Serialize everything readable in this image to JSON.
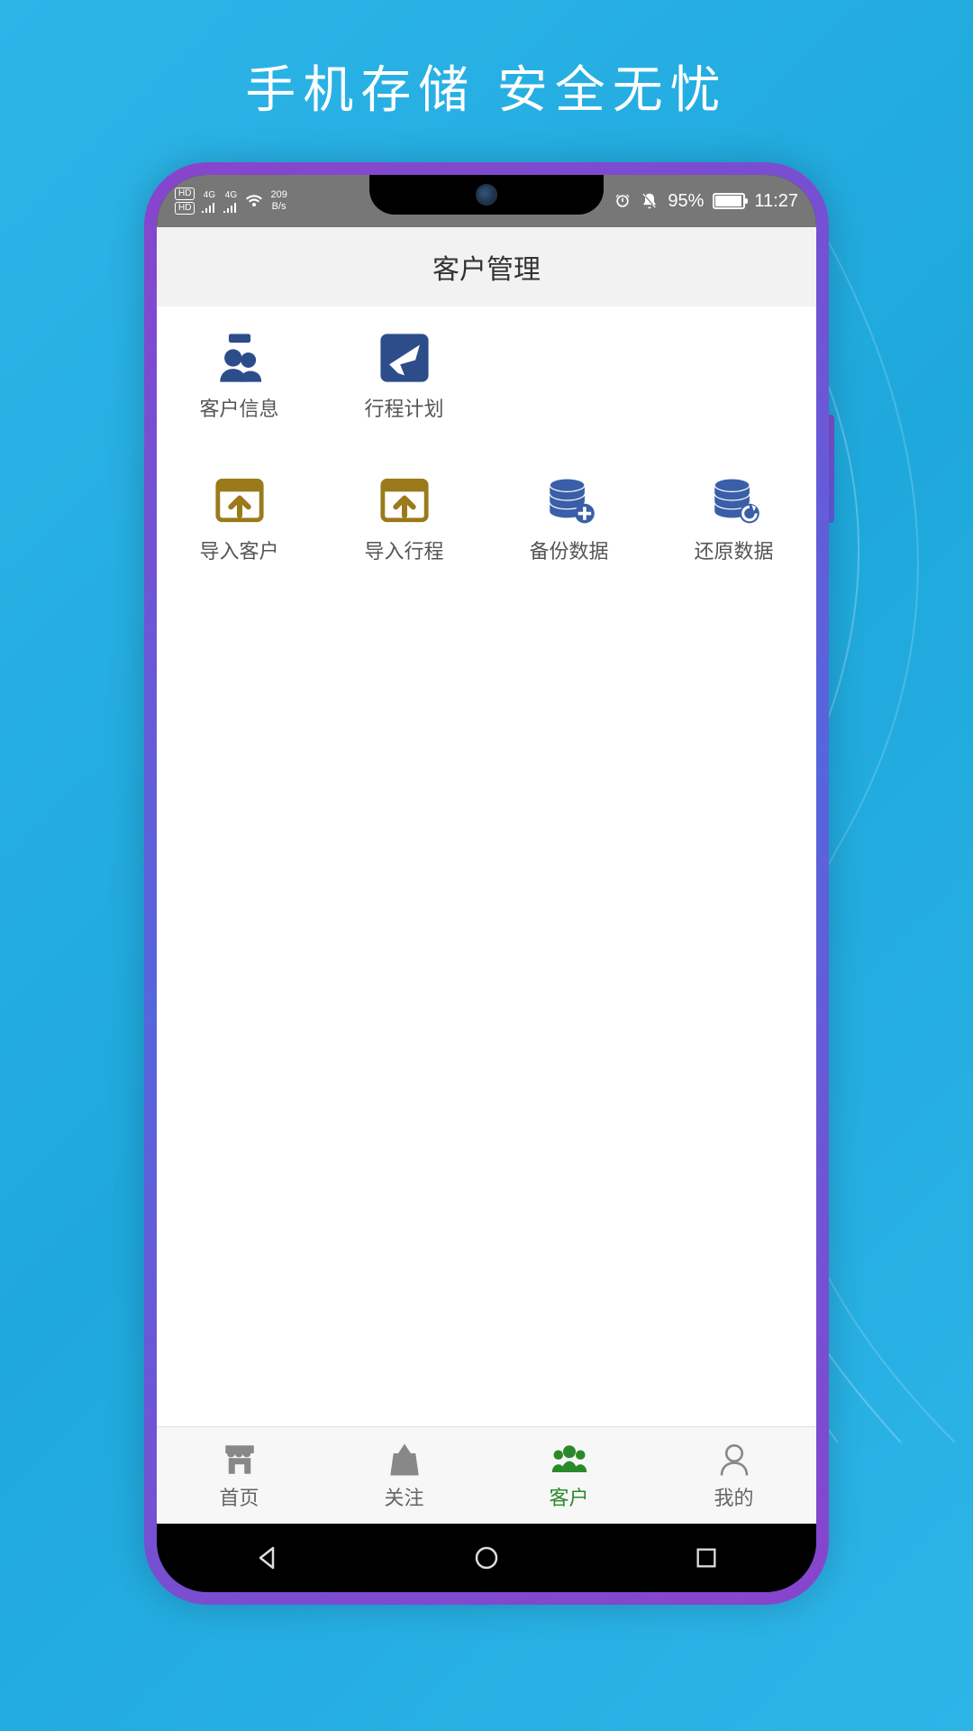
{
  "headline": "手机存储  安全无忧",
  "statusbar": {
    "left": {
      "hd": "HD",
      "netgen": "4G",
      "speed_value": "209",
      "speed_unit": "B/s"
    },
    "right": {
      "battery_percent": "95%",
      "time": "11:27"
    }
  },
  "app": {
    "title": "客户管理",
    "grid": [
      {
        "label": "客户信息",
        "icon": "people",
        "color": "#2d4d8a"
      },
      {
        "label": "行程计划",
        "icon": "plane",
        "color": "#2d4d8a"
      },
      {
        "label": "导入客户",
        "icon": "import",
        "color": "#9a7a1a"
      },
      {
        "label": "导入行程",
        "icon": "import",
        "color": "#9a7a1a"
      },
      {
        "label": "备份数据",
        "icon": "db-plus",
        "color": "#3a5fa8"
      },
      {
        "label": "还原数据",
        "icon": "db-restore",
        "color": "#3a5fa8"
      }
    ],
    "tabs": [
      {
        "label": "首页",
        "icon": "store",
        "active": false
      },
      {
        "label": "关注",
        "icon": "bag",
        "active": false
      },
      {
        "label": "客户",
        "icon": "group",
        "active": true
      },
      {
        "label": "我的",
        "icon": "profile",
        "active": false
      }
    ]
  },
  "colors": {
    "accent_gold": "#9a7a1a",
    "accent_blue": "#2d4d8a",
    "active_green": "#2a8a2a"
  }
}
